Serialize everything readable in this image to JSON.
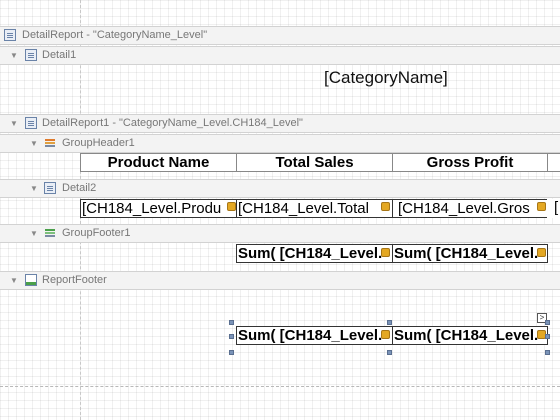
{
  "bands": {
    "detail_report": {
      "label": "DetailReport - \"CategoryName_Level\"",
      "icon": "report-icon"
    },
    "detail1": {
      "label": "Detail1",
      "icon": "report-icon"
    },
    "detail_report1": {
      "label": "DetailReport1 - \"CategoryName_Level.CH184_Level\"",
      "icon": "report-icon"
    },
    "group_header1": {
      "label": "GroupHeader1",
      "icon": "group-header-icon"
    },
    "detail2": {
      "label": "Detail2",
      "icon": "report-icon"
    },
    "group_footer1": {
      "label": "GroupFooter1",
      "icon": "group-footer-icon"
    },
    "report_footer": {
      "label": "ReportFooter",
      "icon": "report-footer-icon"
    }
  },
  "toggle_glyph": "▼",
  "detail1_field": "[CategoryName]",
  "header_cells": [
    "Product Name",
    "Total Sales",
    "Gross Profit"
  ],
  "detail_cells": [
    "[CH184_Level.Produ",
    "[CH184_Level.Total",
    "[CH184_Level.Gros",
    "["
  ],
  "group_footer_cells": [
    "Sum( [CH184_Level.",
    "Sum( [CH184_Level."
  ],
  "report_footer_cells": [
    "Sum( [CH184_Level.",
    "Sum( [CH184_Level."
  ],
  "smart_tag_glyph": ">",
  "colors": {
    "band_bg": "#f3f3f3",
    "badge": "#e4a823",
    "selection": "#7a93b8"
  }
}
